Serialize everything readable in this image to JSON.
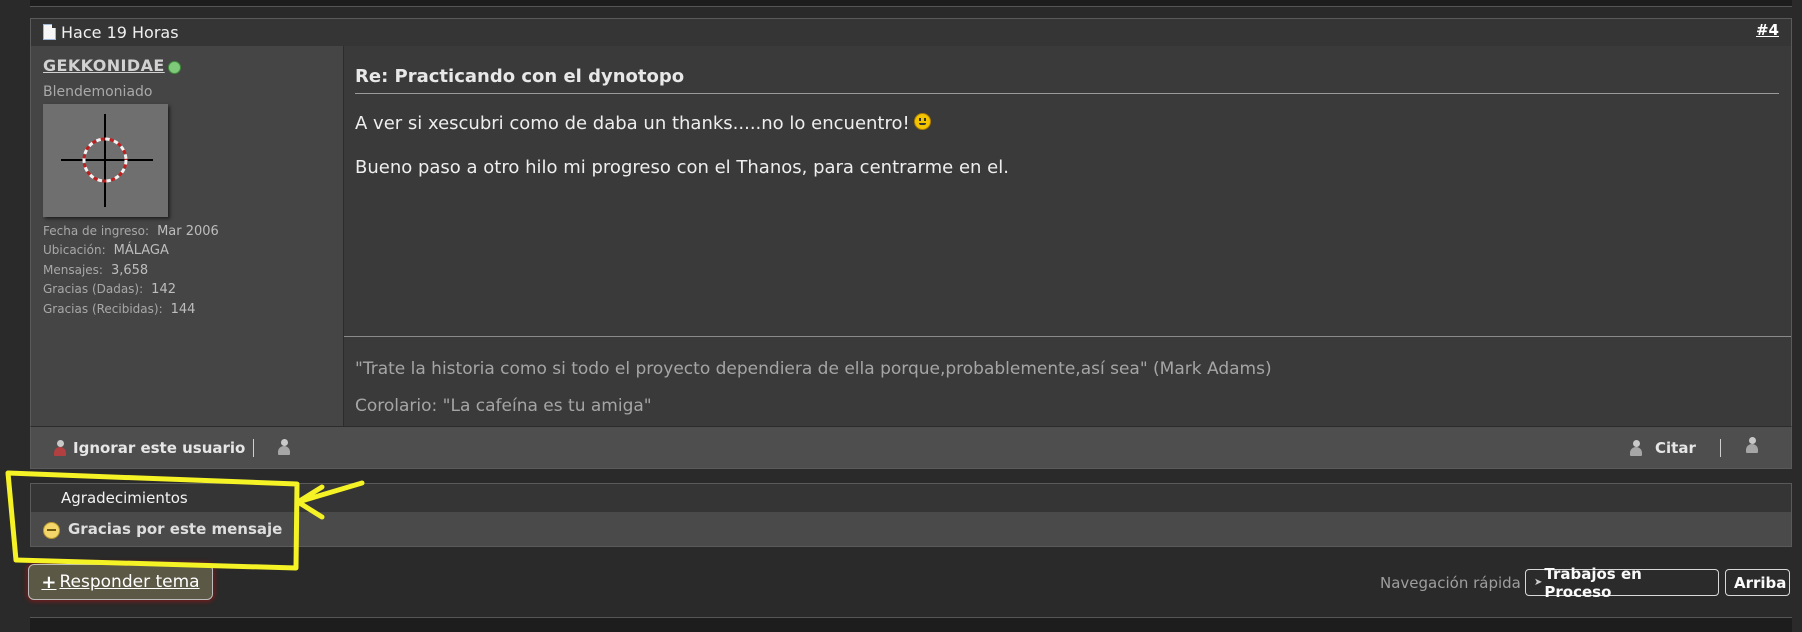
{
  "post_header": {
    "time": "Hace 19 Horas",
    "post_number": "#4"
  },
  "user": {
    "name": "GEKKONIDAE",
    "title": "Blendemoniado",
    "stats": [
      {
        "label": "Fecha de ingreso:",
        "value": "Mar 2006"
      },
      {
        "label": "Ubicación:",
        "value": "MÁLAGA"
      },
      {
        "label": "Mensajes:",
        "value": "3,658"
      },
      {
        "label": "Gracias (Dadas):",
        "value": "142"
      },
      {
        "label": "Gracias (Recibidas):",
        "value": "144"
      }
    ]
  },
  "post": {
    "title": "Re: Practicando con el dynotopo",
    "lines": [
      "A ver si xescubri como de daba un thanks.....no lo encuentro!",
      "Bueno paso a otro hilo mi progreso con el Thanos, para centrarme en el."
    ],
    "signature": [
      "\"Trate la historia como si todo el proyecto dependiera de ella porque,probablemente,así sea\" (Mark Adams)",
      "Corolario: \"La cafeína es tu amiga\""
    ]
  },
  "footer": {
    "ignore_label": "Ignorar este usuario",
    "quote_label": "Citar"
  },
  "thanks": {
    "header": "Agradecimientos",
    "button_label": "Gracias por este mensaje"
  },
  "reply": {
    "plus": "+",
    "label": "Responder tema"
  },
  "quick_nav": {
    "label": "Navegación rápida",
    "forum_label": "Trabajos en Proceso",
    "top_label": "Arriba"
  },
  "colors": {
    "annotation": "#f5f225",
    "online": "#7ec97a"
  }
}
